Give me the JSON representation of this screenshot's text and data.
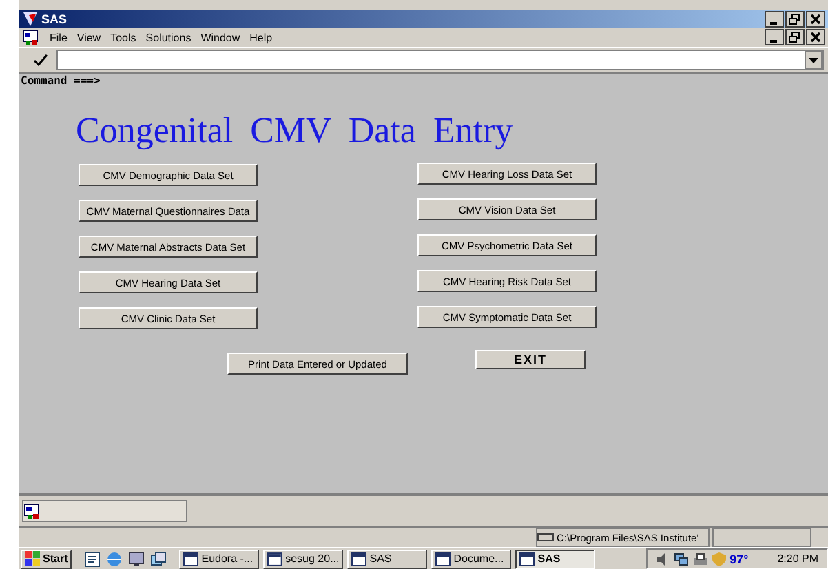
{
  "window": {
    "title": "SAS"
  },
  "menu": [
    "File",
    "View",
    "Tools",
    "Solutions",
    "Window",
    "Help"
  ],
  "command": {
    "label": "Command ===>"
  },
  "app_title": "Congenital CMV Data Entry",
  "buttons_left": [
    "CMV Demographic Data Set",
    "CMV Maternal Questionnaires Data",
    "CMV Maternal Abstracts Data Set",
    "CMV Hearing Data Set",
    "CMV Clinic Data Set"
  ],
  "buttons_right": [
    "CMV Hearing Loss Data Set",
    "CMV Vision Data Set",
    "CMV Psychometric Data Set",
    "CMV Hearing Risk Data Set",
    "CMV Symptomatic Data Set"
  ],
  "print_button": "Print Data Entered or Updated",
  "exit_button": "EXIT",
  "status_bar": {
    "path": "C:\\Program Files\\SAS Institute'"
  },
  "taskbar": {
    "start": "Start",
    "tasks": [
      {
        "label": "Eudora -...",
        "selected": false
      },
      {
        "label": "sesug 20...",
        "selected": false
      },
      {
        "label": "SAS",
        "selected": false
      },
      {
        "label": "Docume...",
        "selected": false
      },
      {
        "label": "SAS",
        "selected": true
      }
    ],
    "temperature": "97°",
    "clock": "2:20 PM"
  }
}
